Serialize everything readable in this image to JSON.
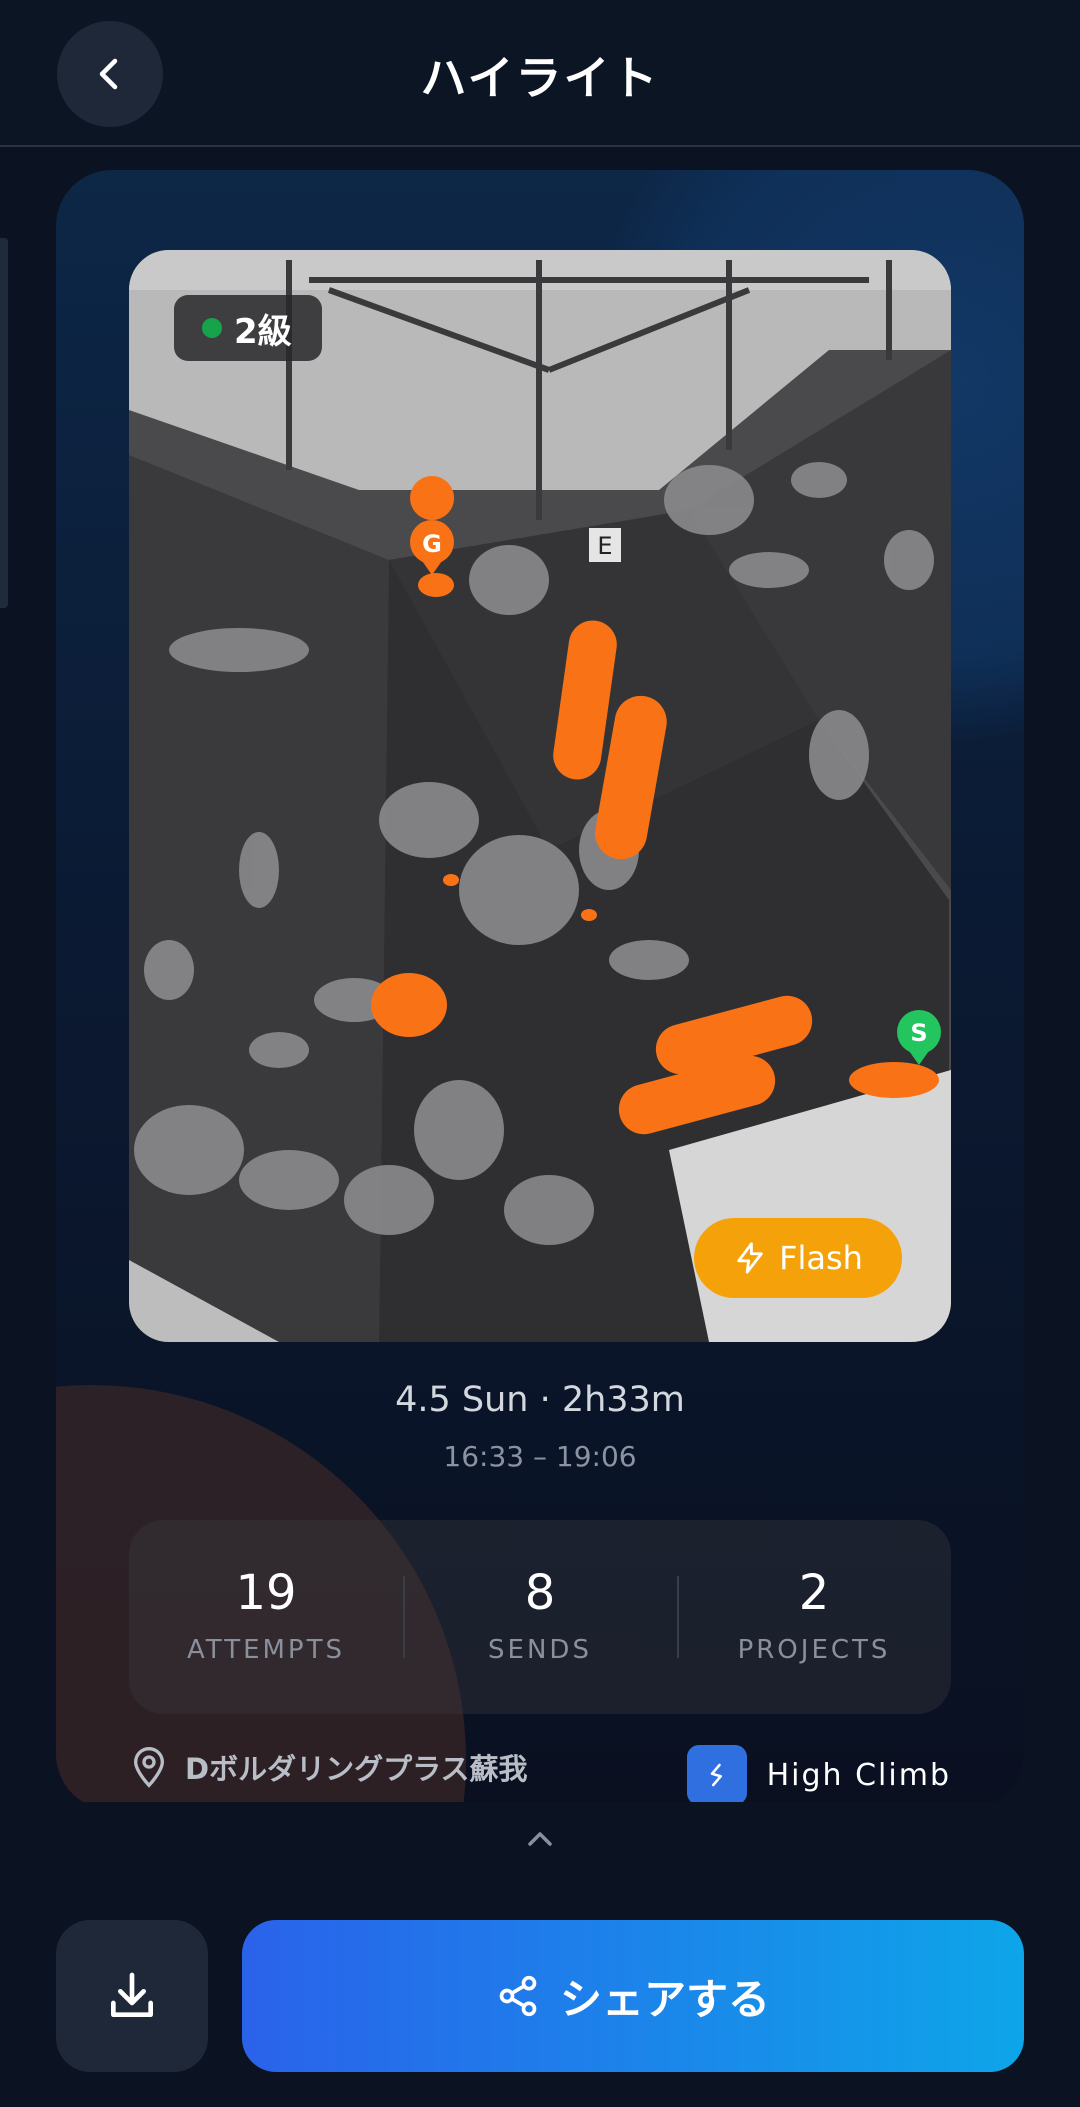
{
  "header": {
    "title": "ハイライト"
  },
  "highlight": {
    "grade": "2級",
    "flash_label": "Flash",
    "start_marker": "S",
    "goal_marker": "G",
    "wall_label": "E",
    "date_line": "4.5 Sun · 2h33m",
    "time_range": "16:33 – 19:06"
  },
  "stats": [
    {
      "value": "19",
      "label": "ATTEMPTS"
    },
    {
      "value": "8",
      "label": "SENDS"
    },
    {
      "value": "2",
      "label": "PROJECTS"
    }
  ],
  "gym_name": "Dボルダリングプラス蘇我",
  "app_name": "High Climb",
  "actions": {
    "share_label": "シェアする"
  },
  "colors": {
    "accent_orange": "#f97316",
    "flash": "#f5a20a",
    "grade_dot": "#16a34a",
    "share_start": "#2a62ea",
    "share_end": "#0ea5e9"
  }
}
